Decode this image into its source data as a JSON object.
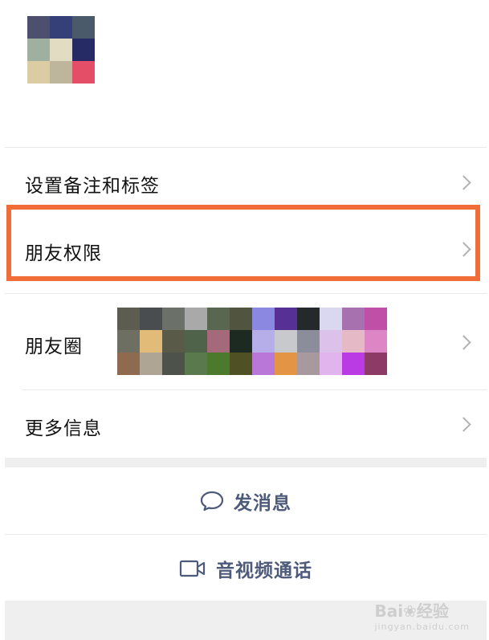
{
  "contact": {
    "avatar_colors": [
      "#4c4f6d",
      "#353f78",
      "#4b5a6b",
      "#9fb0a0",
      "#e2dcc2",
      "#262b66",
      "#dccca4",
      "#bdb59c",
      "#e44e67"
    ]
  },
  "menu": {
    "remark_label": "设置备注和标签",
    "permissions_label": "朋友权限",
    "moments_label": "朋友圈",
    "more_label": "更多信息"
  },
  "moments_thumb_colors": [
    "#5d5c50",
    "#4a4d50",
    "#6b7068",
    "#a9a9aa",
    "#596650",
    "#51543f",
    "#8a88e0",
    "#573096",
    "#24292b",
    "#dad8f0",
    "#a771b0",
    "#c04fa8",
    "#6e6f63",
    "#e3bb78",
    "#5a5a49",
    "#4e6349",
    "#a4697a",
    "#1c2a22",
    "#b5aee9",
    "#c7c9cd",
    "#8b8d9a",
    "#dcc2ea",
    "#e5b9c6",
    "#dd86c6",
    "#8e6b4e",
    "#aea594",
    "#4d524b",
    "#5a7a4d",
    "#4c7a2c",
    "#4f5125",
    "#b977d8",
    "#e49445",
    "#a7999e",
    "#e2b4ee",
    "#ba3be4",
    "#8e3a66"
  ],
  "actions": {
    "message_label": "发消息",
    "call_label": "音视频通话"
  },
  "theme": {
    "accent_text": "#4d5a7a",
    "highlight_border": "#f06d3a"
  },
  "watermark": {
    "main": "Bai❀经验",
    "sub": "jingyan.baidu.com"
  }
}
